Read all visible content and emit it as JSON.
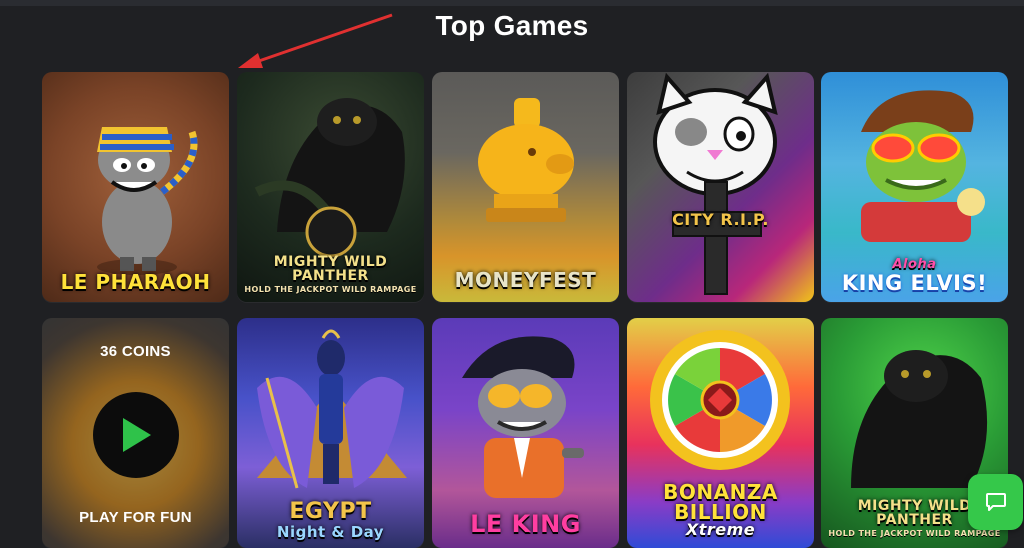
{
  "section": {
    "title": "Top Games"
  },
  "games": [
    {
      "name": "LE PHARAOH",
      "logo_color": "#ffe23a"
    },
    {
      "name": "MIGHTY WILD PANTHER",
      "subtitle": "HOLD THE JACKPOT WILD RAMPAGE",
      "logo_color": "#f4e18a"
    },
    {
      "name": "MONEYFEST",
      "logo_color": "#e8e4c8"
    },
    {
      "name": "CITY R.I.P.",
      "logo_color": "#f3c44a"
    },
    {
      "name_top": "Aloha",
      "name": "KING ELVIS!",
      "logo_color": "#ffffff"
    },
    {
      "coins": "36 COINS",
      "play_label": "PLAY FOR FUN"
    },
    {
      "name": "EGYPT",
      "name_bottom": "Night & Day",
      "logo_color": "#f3c44a"
    },
    {
      "name": "LE KING",
      "logo_color": "#ff3ea1"
    },
    {
      "name": "BONANZA",
      "name2": "BILLION",
      "name3": "Xtreme",
      "logo_color": "#ffe23a"
    },
    {
      "name": "MIGHTY WILD PANTHER",
      "subtitle": "HOLD THE JACKPOT WILD RAMPAGE",
      "logo_color": "#f4e18a"
    }
  ],
  "colors": {
    "background": "#1f2023",
    "chat_button": "#35c84a",
    "play_icon": "#2fc24a",
    "arrow": "#e03030"
  },
  "icons": {
    "play": "play-triangle",
    "chat": "chat-bubble-icon"
  }
}
